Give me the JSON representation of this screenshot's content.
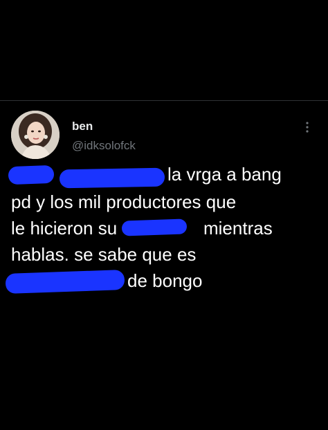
{
  "user": {
    "name": "ben",
    "handle": "@idksolofck"
  },
  "icons": {
    "more": "more-dots-vertical-icon"
  },
  "tweet": {
    "line1_visible": "la vrga a bang",
    "line2": "pd y los mil productores que",
    "line3_start": "le hicieron su",
    "line3_end": "mientras",
    "line4": "hablas. se sabe que es",
    "line5_end": "de bongo"
  },
  "colors": {
    "background": "#000000",
    "text": "#ffffff",
    "secondary_text": "#71767b",
    "redaction": "#1a34ff"
  }
}
